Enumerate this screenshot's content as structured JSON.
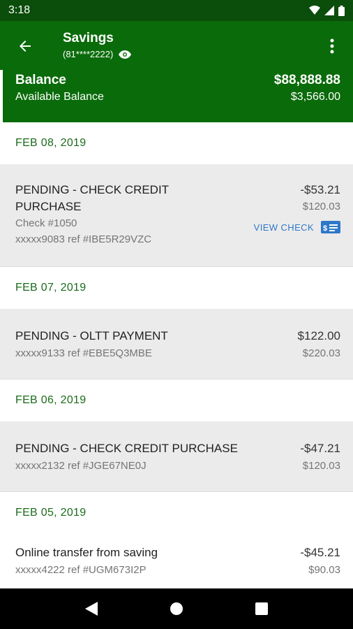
{
  "status": {
    "time": "3:18"
  },
  "header": {
    "title": "Savings",
    "account_masked": "(81****2222)"
  },
  "balance": {
    "label": "Balance",
    "value": "$88,888.88",
    "available_label": "Available Balance",
    "available_value": "$3,566.00"
  },
  "groups": [
    {
      "date": "FEB 08, 2019",
      "transactions": [
        {
          "desc_line1": "PENDING - CHECK CREDIT",
          "desc_line2": "PURCHASE",
          "check": "Check #1050",
          "ref": "xxxxx9083 ref #IBE5R29VZC",
          "amount": "-$53.21",
          "running": "$120.03",
          "action": "VIEW CHECK"
        }
      ]
    },
    {
      "date": "FEB 07, 2019",
      "transactions": [
        {
          "desc": "PENDING - OLTT PAYMENT",
          "ref": "xxxxx9133 ref #EBE5Q3MBE",
          "amount": "$122.00",
          "running": "$220.03"
        }
      ]
    },
    {
      "date": "FEB 06, 2019",
      "transactions": [
        {
          "desc": "PENDING - CHECK CREDIT PURCHASE",
          "ref": "xxxxx2132 ref #JGE67NE0J",
          "amount": "-$47.21",
          "running": "$120.03"
        }
      ]
    },
    {
      "date": "FEB 05, 2019",
      "transactions": [
        {
          "desc": "Online transfer from saving",
          "ref": "xxxxx4222 ref #UGM673I2P",
          "amount": "-$45.21",
          "running": "$90.03"
        }
      ]
    }
  ],
  "colors": {
    "primary": "#0a6b0a",
    "status_bar": "#0b4d0b",
    "date_text": "#1b6b1b",
    "link": "#2e78c9"
  },
  "icons": [
    "back-arrow-icon",
    "eye-icon",
    "more-vert-icon",
    "check-image-icon",
    "wifi-icon",
    "signal-icon",
    "battery-icon",
    "nav-back-icon",
    "nav-home-icon",
    "nav-recents-icon"
  ]
}
